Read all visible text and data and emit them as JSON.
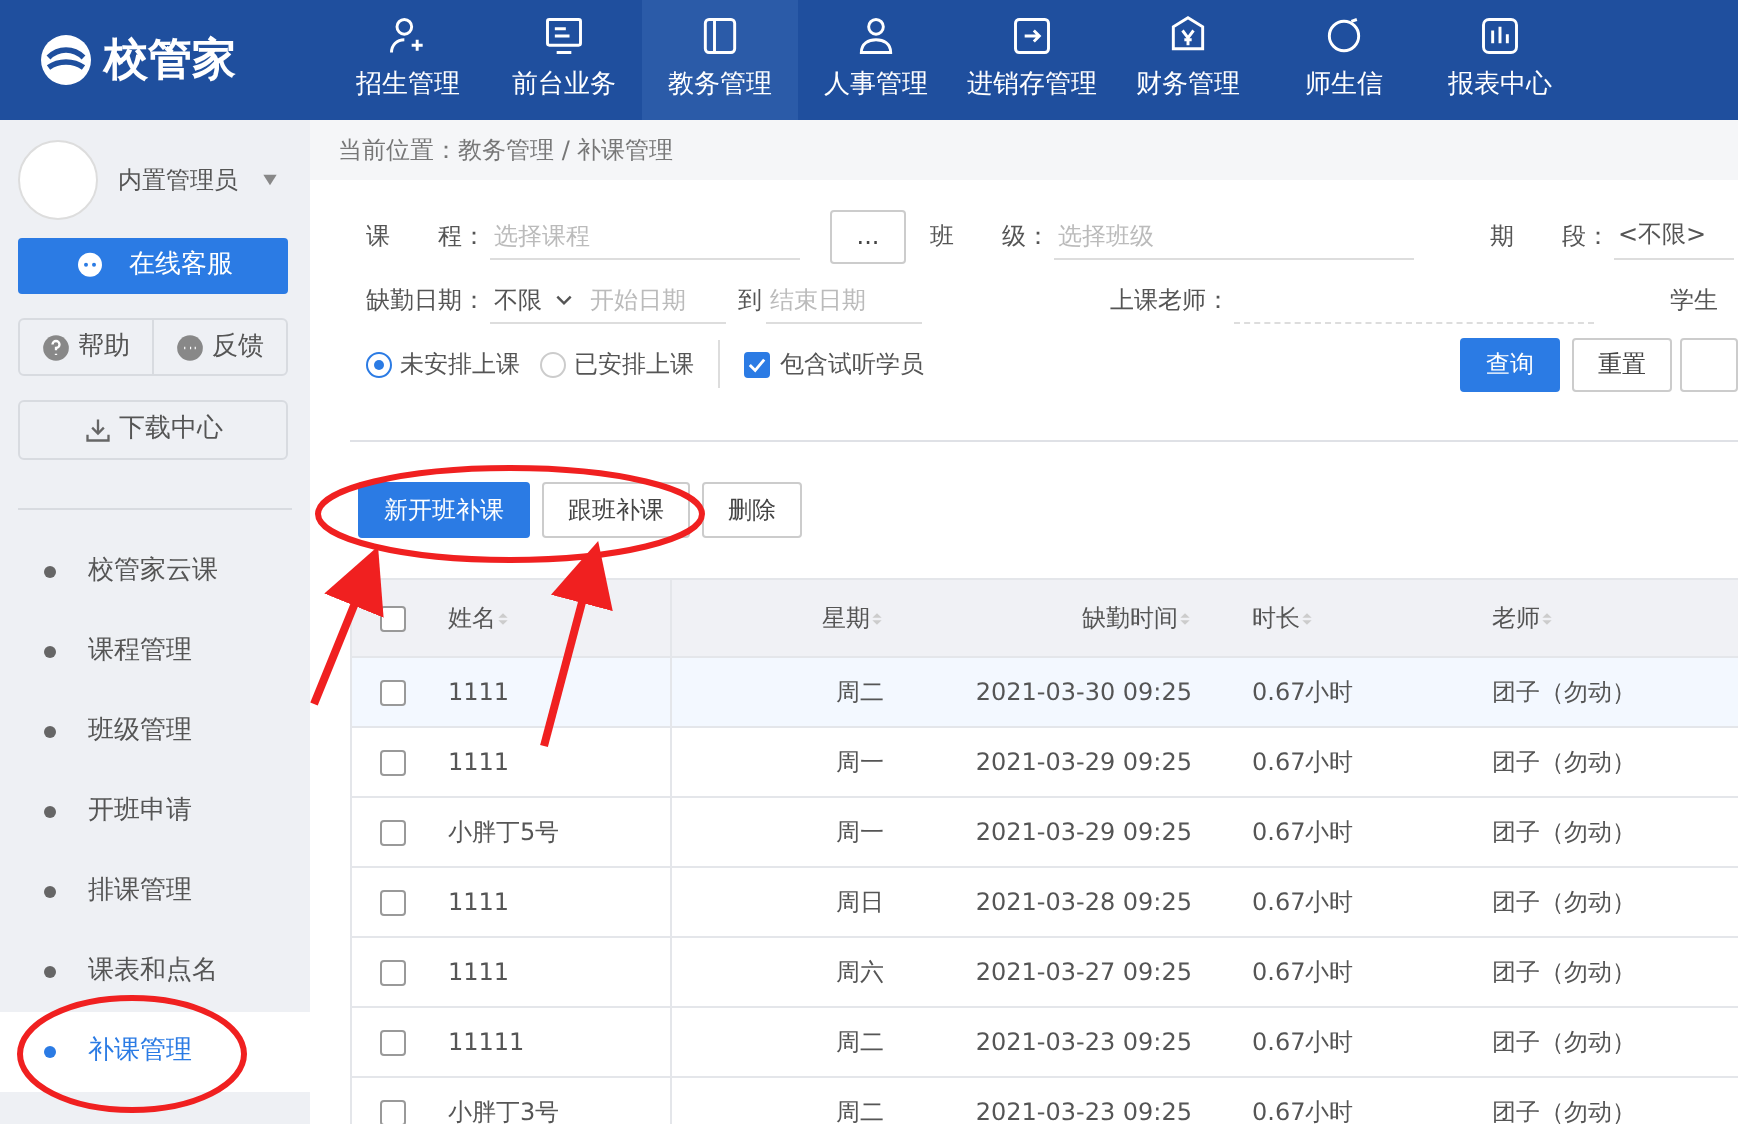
{
  "header": {
    "logo_text": "校管家",
    "nav": [
      {
        "label": "招生管理",
        "selected": false
      },
      {
        "label": "前台业务",
        "selected": false
      },
      {
        "label": "教务管理",
        "selected": true
      },
      {
        "label": "人事管理",
        "selected": false
      },
      {
        "label": "进销存管理",
        "selected": false
      },
      {
        "label": "财务管理",
        "selected": false
      },
      {
        "label": "师生信",
        "selected": false
      },
      {
        "label": "报表中心",
        "selected": false
      }
    ]
  },
  "sidebar": {
    "user_name": "内置管理员",
    "service_button": "在线客服",
    "help_button": "帮助",
    "feedback_button": "反馈",
    "download_button": "下载中心",
    "menu": [
      {
        "label": "校管家云课",
        "selected": false
      },
      {
        "label": "课程管理",
        "selected": false
      },
      {
        "label": "班级管理",
        "selected": false
      },
      {
        "label": "开班申请",
        "selected": false
      },
      {
        "label": "排课管理",
        "selected": false
      },
      {
        "label": "课表和点名",
        "selected": false
      },
      {
        "label": "补课管理",
        "selected": true
      }
    ]
  },
  "breadcrumb": "当前位置：教务管理 / 补课管理",
  "filters": {
    "course_label": "课　　程：",
    "course_placeholder": "选择课程",
    "more_button": "...",
    "class_label": "班　　级：",
    "class_placeholder": "选择班级",
    "period_label": "期　　段：",
    "period_value": "<不限>",
    "absence_label": "缺勤日期：",
    "absence_value": "不限",
    "start_placeholder": "开始日期",
    "to_label": "到",
    "end_placeholder": "结束日期",
    "teacher_label": "上课老师：",
    "student_label": "学生",
    "radios": [
      {
        "label": "未安排上课",
        "selected": true
      },
      {
        "label": "已安排上课",
        "selected": false
      }
    ],
    "trial": {
      "label": "包含试听学员",
      "checked": true
    },
    "query_button": "查询",
    "reset_button": "重置"
  },
  "actions": [
    {
      "label": "新开班补课",
      "kind": "primary"
    },
    {
      "label": "跟班补课",
      "kind": "default"
    },
    {
      "label": "删除",
      "kind": "default"
    }
  ],
  "table": {
    "select_all_checked": false,
    "columns": [
      "姓名",
      "星期",
      "缺勤时间",
      "时长",
      "老师"
    ],
    "rows": [
      {
        "checked": false,
        "cells": [
          "1111",
          "周二",
          "2021-03-30 09:25",
          "0.67小时",
          "团子（勿动）"
        ]
      },
      {
        "checked": false,
        "cells": [
          "1111",
          "周一",
          "2021-03-29 09:25",
          "0.67小时",
          "团子（勿动）"
        ]
      },
      {
        "checked": false,
        "cells": [
          "小胖丁5号",
          "周一",
          "2021-03-29 09:25",
          "0.67小时",
          "团子（勿动）"
        ]
      },
      {
        "checked": false,
        "cells": [
          "1111",
          "周日",
          "2021-03-28 09:25",
          "0.67小时",
          "团子（勿动）"
        ]
      },
      {
        "checked": false,
        "cells": [
          "1111",
          "周六",
          "2021-03-27 09:25",
          "0.67小时",
          "团子（勿动）"
        ]
      },
      {
        "checked": false,
        "cells": [
          "11111",
          "周二",
          "2021-03-23 09:25",
          "0.67小时",
          "团子（勿动）"
        ]
      },
      {
        "checked": false,
        "cells": [
          "小胖丁3号",
          "周二",
          "2021-03-23 09:25",
          "0.67小时",
          "团子（勿动）"
        ]
      }
    ]
  }
}
